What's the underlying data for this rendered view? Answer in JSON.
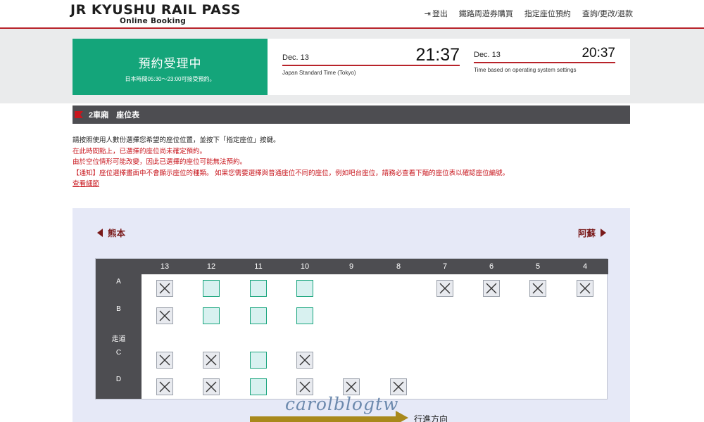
{
  "header": {
    "logo_main": "JR KYUSHU RAIL PASS",
    "logo_sub": "Online Booking",
    "nav": {
      "logout": "登出",
      "buy_pass": "鐵路周遊券購買",
      "reserve": "指定座位預約",
      "manage": "查詢/更改/退款"
    }
  },
  "status": {
    "title": "預約受理中",
    "subtitle": "日本時間05:30～23:00可接受預約。"
  },
  "clocks": [
    {
      "date": "Dec. 13",
      "time": "21:37",
      "label": "Japan Standard Time (Tokyo)"
    },
    {
      "date": "Dec. 13",
      "time": "20:37",
      "label": "Time based on operating system settings"
    }
  ],
  "section": {
    "title": "2車廂　座位表"
  },
  "instructions": {
    "line1": "請按照使用人數份選擇您希望的座位位置，並按下「指定座位」按鍵。",
    "line2": "在此時間點上，已選擇的座位尚未確定預約。",
    "line3": "由於空位情形可能改變，因此已選擇的座位可能無法預約。",
    "line4": "【通知】座位選擇畫面中不會顯示座位的種類。 如果您需要選擇與普通座位不同的座位，例如吧台座位，請務必查看下麵的座位表以確認座位編號。",
    "details_link": "查看細節"
  },
  "seatmap": {
    "left_station": "熊本",
    "right_station": "阿蘇",
    "columns": [
      "13",
      "12",
      "11",
      "10",
      "9",
      "8",
      "7",
      "6",
      "5",
      "4"
    ],
    "row_labels": {
      "a": "A",
      "b": "B",
      "aisle": "走道",
      "c": "C",
      "d": "D"
    },
    "rows": {
      "A": [
        "taken",
        "avail",
        "avail",
        "avail",
        "none",
        "none",
        "taken",
        "taken",
        "taken",
        "taken"
      ],
      "B": [
        "taken",
        "avail",
        "avail",
        "avail",
        "none",
        "none",
        "none",
        "none",
        "none",
        "none"
      ],
      "C": [
        "taken",
        "taken",
        "avail",
        "taken",
        "none",
        "none",
        "none",
        "none",
        "none",
        "none"
      ],
      "D": [
        "taken",
        "taken",
        "avail",
        "taken",
        "taken",
        "taken",
        "none",
        "none",
        "none",
        "none"
      ]
    },
    "direction_label": "行進方向"
  },
  "watermark": "carolblogtw",
  "colors": {
    "brand_red": "#b8232a",
    "status_green": "#14a57a",
    "header_dark": "#4d4d51",
    "available": "#d8f1f0",
    "available_border": "#19a57d"
  }
}
